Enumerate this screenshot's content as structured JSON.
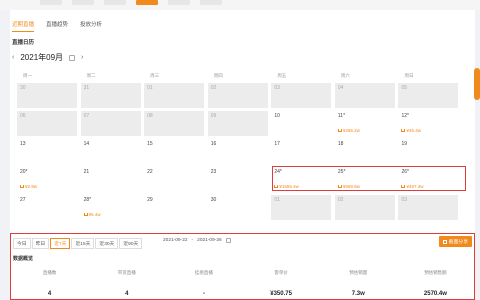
{
  "subtabs": [
    "近期直播",
    "直播趋势",
    "投放分析"
  ],
  "section_title": "直播日历",
  "month": "2021年09月",
  "weekdays": [
    "周一",
    "周二",
    "周三",
    "周四",
    "周五",
    "周六",
    "周日"
  ],
  "calendar_rows": [
    [
      {
        "num": "30",
        "gray": true
      },
      {
        "num": "31",
        "gray": true
      },
      {
        "num": "01",
        "gray": true
      },
      {
        "num": "02",
        "gray": true
      },
      {
        "num": "03",
        "gray": true
      },
      {
        "num": "04",
        "gray": true
      },
      {
        "num": "05",
        "gray": true
      }
    ],
    [
      {
        "num": "06",
        "gray": true
      },
      {
        "num": "07",
        "gray": true
      },
      {
        "num": "08",
        "gray": true
      },
      {
        "num": "09",
        "gray": true
      },
      {
        "num": "10",
        "gray": false
      },
      {
        "num": "11*",
        "gray": false,
        "amt": "¥255.2w"
      },
      {
        "num": "12*",
        "gray": false,
        "amt": "¥45.4w"
      }
    ],
    [
      {
        "num": "13",
        "gray": false
      },
      {
        "num": "14",
        "gray": false
      },
      {
        "num": "15",
        "gray": false
      },
      {
        "num": "16",
        "gray": false
      },
      {
        "num": "17",
        "gray": false
      },
      {
        "num": "18",
        "gray": false
      },
      {
        "num": "19",
        "gray": false
      }
    ],
    [
      {
        "num": "20*",
        "gray": false,
        "amt": "¥2.9w"
      },
      {
        "num": "21",
        "gray": false
      },
      {
        "num": "22",
        "gray": false
      },
      {
        "num": "23",
        "gray": false
      },
      {
        "num": "24*",
        "gray": false,
        "amt": "¥1555.4w"
      },
      {
        "num": "25*",
        "gray": false,
        "amt": "¥559.6w"
      },
      {
        "num": "26*",
        "gray": false,
        "amt": "¥457.4w"
      }
    ],
    [
      {
        "num": "27",
        "gray": false
      },
      {
        "num": "28*",
        "gray": false,
        "amt": "¥5.4w"
      },
      {
        "num": "29",
        "gray": false
      },
      {
        "num": "30",
        "gray": false
      },
      {
        "num": "01",
        "gray": true
      },
      {
        "num": "02",
        "gray": true
      },
      {
        "num": "03",
        "gray": true
      }
    ]
  ],
  "ranges": [
    "今日",
    "昨日",
    "近7天",
    "近15天",
    "近30天",
    "近90天"
  ],
  "active_range": "近7天",
  "date_start": "2021-09-22",
  "date_sep": "-",
  "date_end": "2021-09-26",
  "share_label": "截图分享",
  "overview_title": "数据概览",
  "stats": [
    {
      "label": "直播数",
      "value": "4"
    },
    {
      "label": "带货直播",
      "value": "4"
    },
    {
      "label": "挂榜直播",
      "value": "-"
    },
    {
      "label": "客单价",
      "value": "¥350.75"
    },
    {
      "label": "预估销量",
      "value": "7.3w"
    },
    {
      "label": "预估销售额",
      "value": "2570.4w"
    }
  ],
  "colors": {
    "accent": "#f08a1c",
    "highlight": "#e23b3b"
  }
}
